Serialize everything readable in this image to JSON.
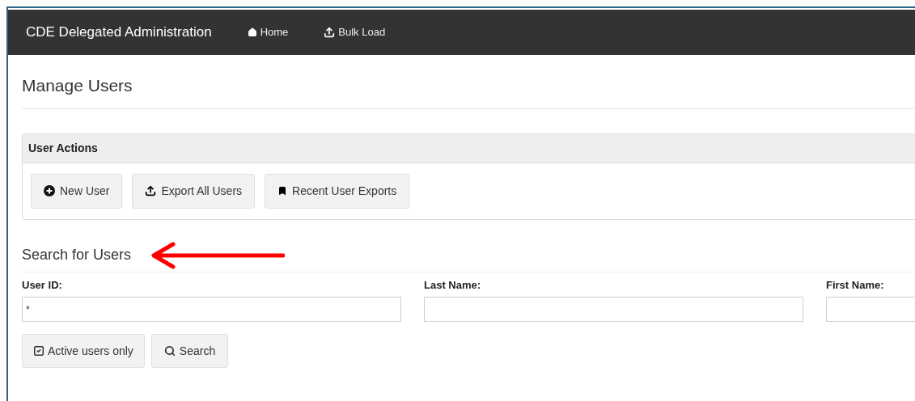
{
  "navbar": {
    "brand": "CDE Delegated Administration",
    "links": [
      {
        "label": "Home"
      },
      {
        "label": "Bulk Load"
      }
    ]
  },
  "page_title": "Manage Users",
  "user_actions": {
    "title": "User Actions",
    "buttons": [
      {
        "label": "New User"
      },
      {
        "label": "Export All Users"
      },
      {
        "label": "Recent User Exports"
      }
    ]
  },
  "search": {
    "title": "Search for Users",
    "fields": [
      {
        "label": "User ID:",
        "value": "*"
      },
      {
        "label": "Last Name:"
      },
      {
        "label": "First Name:"
      }
    ],
    "active_only": {
      "label": "Active users only",
      "checked": true
    },
    "search_button": "Search"
  }
}
